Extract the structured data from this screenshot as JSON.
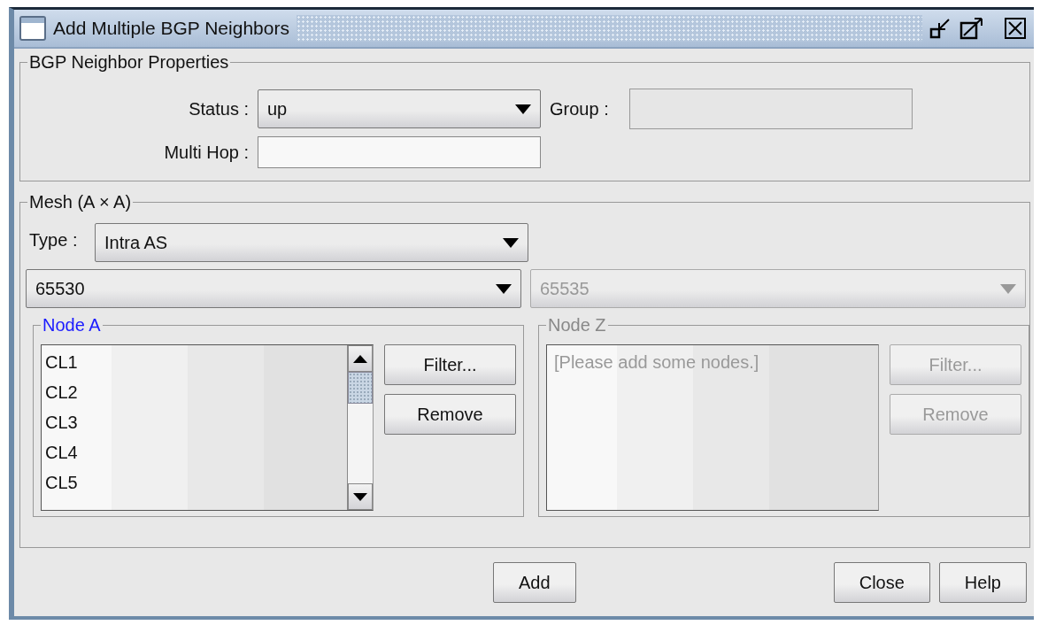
{
  "window": {
    "title": "Add Multiple BGP Neighbors"
  },
  "properties": {
    "title": "BGP Neighbor Properties",
    "status": {
      "label": "Status :",
      "value": "up"
    },
    "group": {
      "label": "Group :",
      "disabled": true
    },
    "multi_hop": {
      "label": "Multi Hop :",
      "disabled": false
    }
  },
  "mesh": {
    "title": "Mesh (A × A)",
    "type": {
      "label": "Type :",
      "value": "Intra AS"
    },
    "as_selectors": [
      {
        "value": "65530",
        "disabled": false
      },
      {
        "value": "65535",
        "disabled": true
      }
    ],
    "nodes": [
      {
        "title": "Node A",
        "disabled": false,
        "items": [
          "CL1",
          "CL2",
          "CL3",
          "CL4",
          "CL5"
        ],
        "buttons": [
          "Filter...",
          "Remove"
        ]
      },
      {
        "title": "Node Z",
        "disabled": true,
        "placeholder": "[Please add some nodes.]",
        "buttons": [
          "Filter...",
          "Remove"
        ]
      }
    ]
  },
  "buttons": [
    "Add",
    "Close",
    "Help"
  ]
}
